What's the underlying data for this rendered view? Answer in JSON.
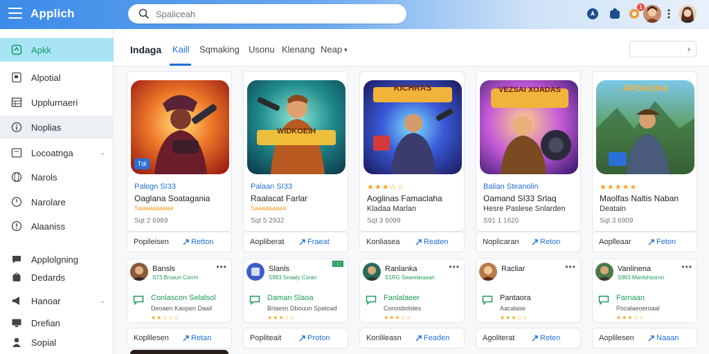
{
  "app": {
    "title": "Applich"
  },
  "search": {
    "placeholder": "Spaliceah"
  },
  "topbar": {
    "notification_count": "1"
  },
  "sidebar": {
    "items": [
      {
        "label": "Apkk",
        "icon": "app-icon"
      },
      {
        "label": "Alpotial",
        "icon": "document-icon"
      },
      {
        "label": "Upplurnaeri",
        "icon": "grid-icon"
      },
      {
        "label": "Noplias",
        "icon": "info-icon"
      },
      {
        "label": "Locoatnga",
        "icon": "folder-icon"
      },
      {
        "label": "Narols",
        "icon": "globe-icon"
      },
      {
        "label": "Narolare",
        "icon": "clock-icon"
      },
      {
        "label": "Alaaniss",
        "icon": "info-icon"
      },
      {
        "label": "Applolgning",
        "icon": "chat-icon"
      },
      {
        "label": "Dedards",
        "icon": "bag-icon"
      },
      {
        "label": "Hanoar",
        "icon": "megaphone-icon"
      },
      {
        "label": "Drefian",
        "icon": "monitor-icon"
      },
      {
        "label": "Sopial",
        "icon": "user-icon"
      }
    ]
  },
  "tabs": [
    {
      "label": "Indaga"
    },
    {
      "label": "Kaill"
    },
    {
      "label": "Sqmaking"
    },
    {
      "label": "Usonu"
    },
    {
      "label": "Klenang"
    },
    {
      "label": "Neap"
    }
  ],
  "games": [
    {
      "category": "Palegn SI33",
      "title": "Oaglana Soatagania",
      "subtitle": "Saaaaaaaaaa",
      "meta": "Sqt 2 6989",
      "art_text": "",
      "badge": "Tdl"
    },
    {
      "category": "Palaan SI33",
      "title": "Raalacat Farlar",
      "subtitle": "Saaaaaaaaa",
      "meta": "Sqt 5 2932",
      "art_text": "WIDKOEIH",
      "badge": ""
    },
    {
      "category": "",
      "title": "Aoglinas Famaclaha",
      "subtitle": "Kladaa Marlan",
      "meta": "Sqt 3 6099",
      "art_text": "KICHRAS",
      "badge": ""
    },
    {
      "category": "Balian Steanolin",
      "title": "Oamand SI33 Srlaq",
      "subtitle": "Hesre Paslese Snlarden",
      "meta": "S91 1 1620",
      "art_text": "VEZSAI XOADAS",
      "badge": ""
    },
    {
      "category": "",
      "title": "Maolfas Naltis Naban",
      "subtitle": "Deatain",
      "meta": "Sqt 3 6909",
      "art_text": "APOAUKA",
      "badge": ""
    }
  ],
  "action_row": [
    {
      "primary": "Popileisen",
      "secondary": "Retton"
    },
    {
      "primary": "Aopliberat",
      "secondary": "Fraeat"
    },
    {
      "primary": "Konliasea",
      "secondary": "Reaten"
    },
    {
      "primary": "Noplicaran",
      "secondary": "Reton"
    },
    {
      "primary": "Aoplleaar",
      "secondary": "Feton"
    }
  ],
  "reviews": [
    {
      "name": "Bansls",
      "sub": "S73 Brsaun Corrm",
      "line1": "Conlascon Selalsol",
      "line2": "Deoaen Kaopen Daall"
    },
    {
      "name": "Slanls",
      "sub": "S983 Snaaly Coran",
      "line1": "Daman Slaoa",
      "line2": "Brlaesn Dbouun Spatoad"
    },
    {
      "name": "Ranlanka",
      "sub": "S1RG Searelarasan",
      "line1": "Fanlalaeer",
      "line2": "Conosbolstes"
    },
    {
      "name": "Racliar",
      "sub": "",
      "line1": "Pantaora",
      "line2": "Aacalase"
    },
    {
      "name": "Vanlinena",
      "sub": "S983 Manlohsornn",
      "line1": "Farnaan",
      "line2": "Pocalaeoeroaal"
    }
  ],
  "action_row_2": [
    {
      "primary": "Koplilesen",
      "secondary": "Retan"
    },
    {
      "primary": "Popliteait",
      "secondary": "Proton"
    },
    {
      "primary": "Konlileasn",
      "secondary": "Feaden"
    },
    {
      "primary": "Agoliterat",
      "secondary": "Reten"
    },
    {
      "primary": "Aoplilesen",
      "secondary": "Naaan"
    }
  ],
  "colors": {
    "accent": "#1f6fd6",
    "active_bg": "#a9e4f4",
    "active_text": "#159b6a",
    "star": "#f5a623"
  }
}
